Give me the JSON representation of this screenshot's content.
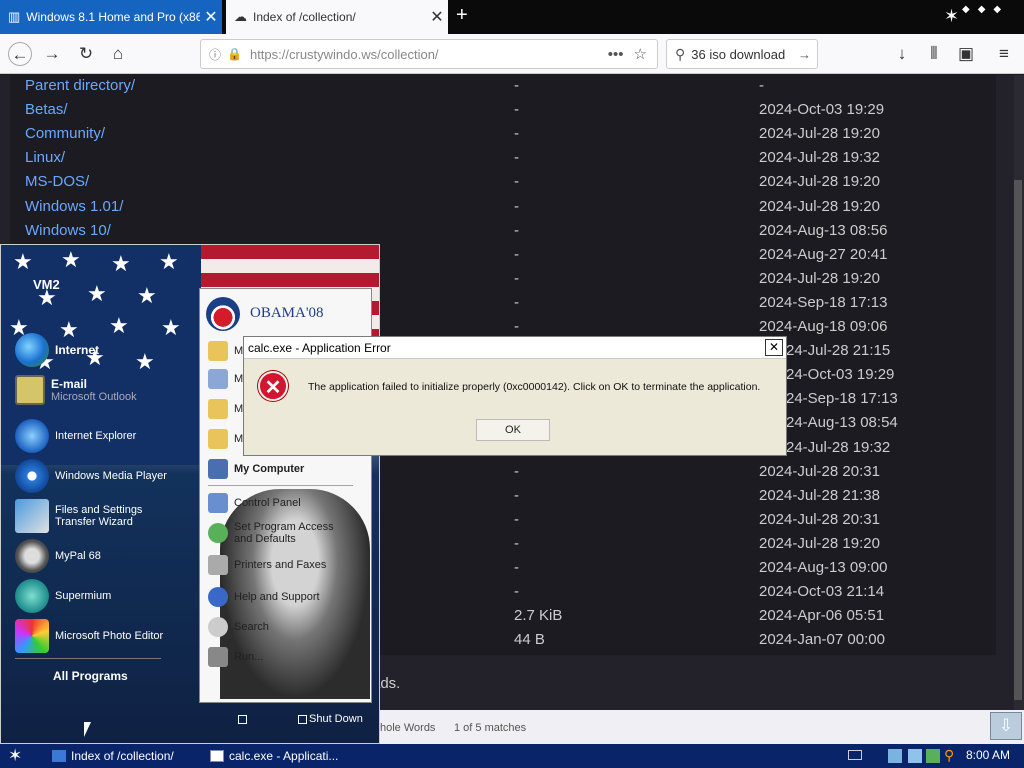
{
  "browser": {
    "tabs": [
      {
        "title": "Windows 8.1 Home and Pro (x86 a",
        "close": "✕"
      },
      {
        "title": "Index of /collection/",
        "close": "✕"
      }
    ],
    "new_tab": "+",
    "url": "https://crustywindo.ws/collection/",
    "search_text": "36 iso download"
  },
  "listing": [
    {
      "name": "Parent directory/",
      "size": "-",
      "date": "-"
    },
    {
      "name": "Betas/",
      "size": "-",
      "date": "2024-Oct-03 19:29"
    },
    {
      "name": "Community/",
      "size": "-",
      "date": "2024-Jul-28 19:20"
    },
    {
      "name": "Linux/",
      "size": "-",
      "date": "2024-Jul-28 19:32"
    },
    {
      "name": "MS-DOS/",
      "size": "-",
      "date": "2024-Jul-28 19:20"
    },
    {
      "name": "Windows 1.01/",
      "size": "-",
      "date": "2024-Jul-28 19:20"
    },
    {
      "name": "Windows 10/",
      "size": "-",
      "date": "2024-Aug-13 08:56"
    },
    {
      "name": "",
      "size": "-",
      "date": "2024-Aug-27 20:41"
    },
    {
      "name": "",
      "size": "-",
      "date": "2024-Jul-28 19:20"
    },
    {
      "name": "",
      "size": "-",
      "date": "2024-Sep-18 17:13"
    },
    {
      "name": "",
      "size": "-",
      "date": "2024-Aug-18 09:06"
    },
    {
      "name": "",
      "size": "",
      "date": "24-Jul-28 21:15"
    },
    {
      "name": "",
      "size": "",
      "date": "24-Oct-03 19:29"
    },
    {
      "name": "",
      "size": "",
      "date": "24-Sep-18 17:13"
    },
    {
      "name": "",
      "size": "",
      "date": "24-Aug-13 08:54"
    },
    {
      "name": "",
      "size": "",
      "date": "24-Jul-28 19:32"
    },
    {
      "name": "",
      "size": "-",
      "date": "2024-Jul-28 20:31"
    },
    {
      "name": "",
      "size": "-",
      "date": "2024-Jul-28 21:38"
    },
    {
      "name": "",
      "size": "-",
      "date": "2024-Jul-28 20:31"
    },
    {
      "name": "",
      "size": "-",
      "date": "2024-Jul-28 19:20"
    },
    {
      "name": "",
      "size": "-",
      "date": "2024-Aug-13 09:00"
    },
    {
      "name": "",
      "size": "-",
      "date": "2024-Oct-03 21:14"
    },
    {
      "name": "",
      "size": "2.7 KiB",
      "date": "2024-Apr-06 05:51"
    },
    {
      "name": "",
      "size": "44 B",
      "date": "2024-Jan-07 00:00"
    }
  ],
  "page_footer_text": "ads.",
  "findbar": {
    "whole_words": "hole Words",
    "matches": "1 of 5 matches"
  },
  "start_menu": {
    "username": "VM2",
    "pinned": [
      {
        "title": "Internet",
        "subtitle": ""
      },
      {
        "title": "E-mail",
        "subtitle": "Microsoft Outlook"
      }
    ],
    "recent": [
      "Internet Explorer",
      "Windows Media Player",
      "Files and Settings Transfer Wizard",
      "MyPal 68",
      "Supermium",
      "Microsoft Photo Editor"
    ],
    "all_programs": "All Programs",
    "brand": "OBAMA'08",
    "right_items": [
      {
        "label": "M"
      },
      {
        "label": "M"
      },
      {
        "label": "M"
      },
      {
        "label": "M"
      },
      {
        "label": "My Computer"
      },
      {
        "label": "Control Panel"
      },
      {
        "label": "Set Program Access and Defaults"
      },
      {
        "label": "Printers and Faxes"
      },
      {
        "label": "Help and Support"
      },
      {
        "label": "Search"
      },
      {
        "label": "Run..."
      }
    ],
    "shut_down": "Shut Down"
  },
  "dialog": {
    "title": "calc.exe - Application Error",
    "close": "✕",
    "message": "The application failed to initialize properly (0xc0000142). Click on OK to terminate the application.",
    "ok": "OK"
  },
  "taskbar": {
    "items": [
      "Index of /collection/",
      "calc.exe - Applicati..."
    ],
    "clock": "8:00 AM"
  },
  "colors": {
    "link": "#6aa8ff",
    "tab_active": "#1565c0",
    "taskbar": "#0a246a",
    "error": "#d3162f"
  }
}
